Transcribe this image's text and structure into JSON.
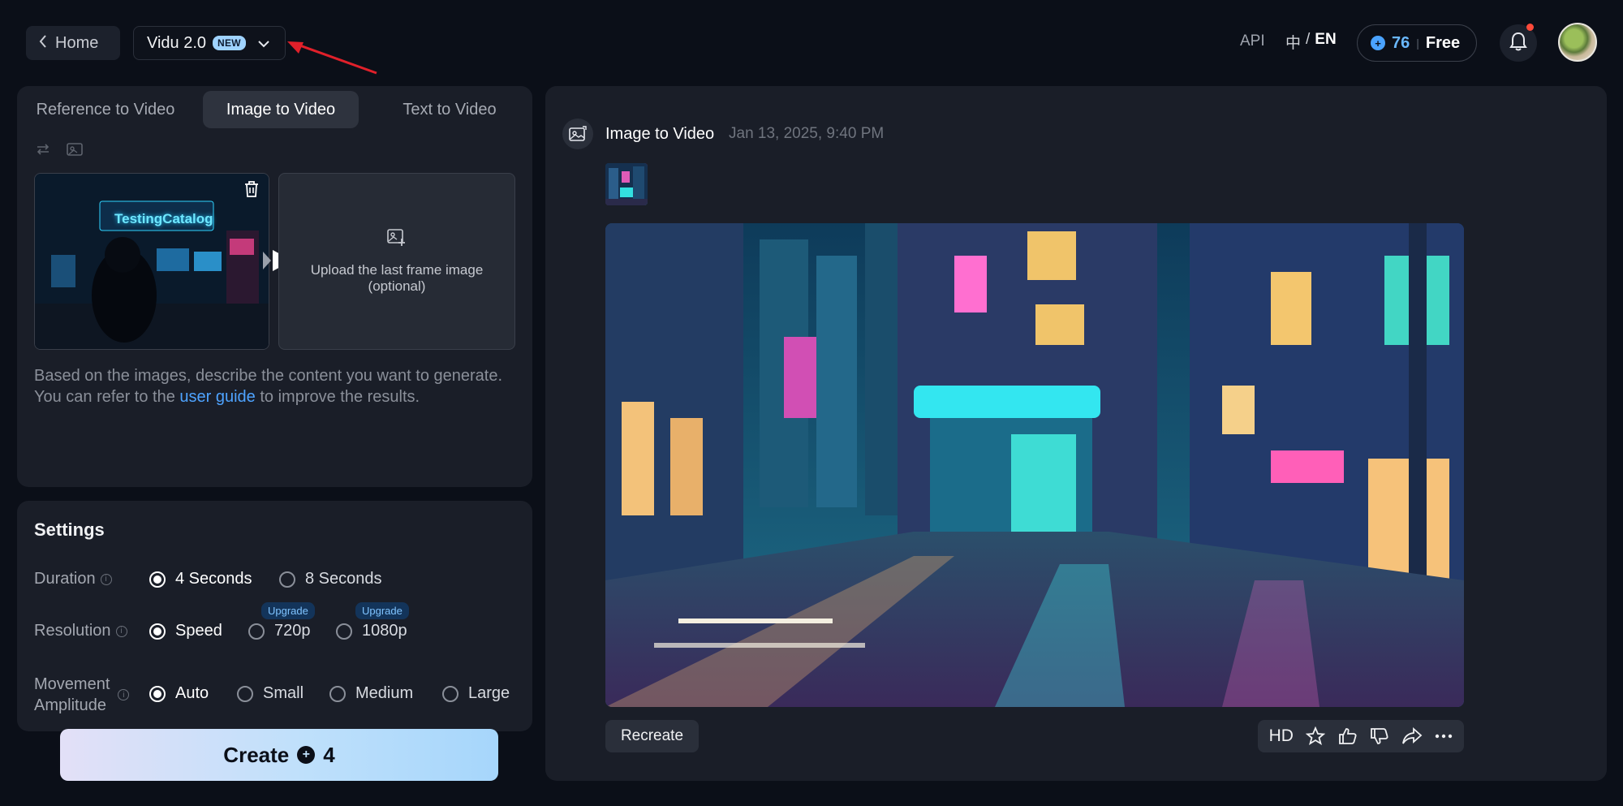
{
  "header": {
    "home_label": "Home",
    "model_name": "Vidu 2.0",
    "model_badge": "NEW",
    "api_label": "API",
    "lang_zh": "中",
    "lang_sep": "/",
    "lang_en": "EN",
    "credits": "76",
    "plan": "Free"
  },
  "tabs": [
    {
      "label": "Reference to Video"
    },
    {
      "label": "Image to Video"
    },
    {
      "label": "Text to Video"
    }
  ],
  "frames": {
    "first_frame_text": "TestingCatalog",
    "upload_line1": "Upload the last frame image",
    "upload_line2": "(optional)"
  },
  "prompt": {
    "text_before": "Based on the images, describe the content you want to generate. You can refer to the ",
    "link": "user guide",
    "text_after": " to improve the results."
  },
  "settings": {
    "title": "Settings",
    "duration": {
      "label": "Duration",
      "options": [
        "4 Seconds",
        "8 Seconds"
      ],
      "selected": "4 Seconds"
    },
    "resolution": {
      "label": "Resolution",
      "options": [
        "Speed",
        "720p",
        "1080p"
      ],
      "selected": "Speed",
      "upgrade_label": "Upgrade"
    },
    "movement": {
      "label_line1": "Movement",
      "label_line2": "Amplitude",
      "options": [
        "Auto",
        "Small",
        "Medium",
        "Large"
      ],
      "selected": "Auto"
    }
  },
  "create": {
    "label": "Create",
    "cost": "4"
  },
  "task": {
    "title": "Image to Video",
    "timestamp": "Jan 13, 2025, 9:40 PM",
    "recreate_label": "Recreate",
    "hd_label": "HD"
  },
  "colors": {
    "background": "#0b0f18",
    "panel": "#1a1e28",
    "accent_blue": "#4ea3ff",
    "create_gradient_start": "#e3e0f7",
    "create_gradient_end": "#a6d6fb",
    "annotation_arrow": "#e0202a"
  }
}
